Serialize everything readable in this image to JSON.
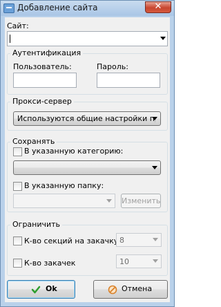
{
  "window": {
    "title": "Добавление сайта",
    "close_symbol": "✕"
  },
  "site": {
    "label": "Сайт:",
    "value": ""
  },
  "auth": {
    "title": "Аутентификация",
    "user_label": "Пользователь:",
    "user_value": "",
    "password_label": "Пароль:",
    "password_value": ""
  },
  "proxy": {
    "title": "Прокси-сервер",
    "selected": "Используются общие настройки про"
  },
  "save": {
    "title": "Сохранять",
    "category_label": "В указанную категорию:",
    "category_checked": false,
    "category_value": "",
    "folder_label": "В указанную папку:",
    "folder_checked": false,
    "folder_value": "",
    "change_button": "Изменить"
  },
  "limit": {
    "title": "Ограничить",
    "sections_label": "К-во секций на закачку",
    "sections_checked": false,
    "sections_value": "8",
    "downloads_label": "К-во закачек",
    "downloads_checked": false,
    "downloads_value": "10"
  },
  "buttons": {
    "ok": "Ok",
    "cancel": "Отмена"
  },
  "colors": {
    "titlebar": "#b9d1ea",
    "close": "#c8462f",
    "ok_icon": "#2e9e2e",
    "cancel_icon": "#d9822b"
  }
}
